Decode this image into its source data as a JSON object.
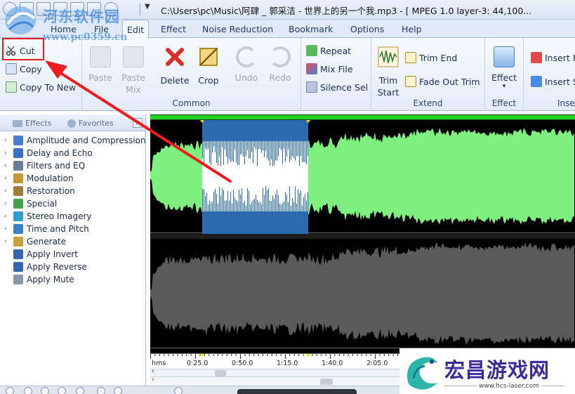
{
  "window": {
    "title": "C:\\Users\\pc\\Music\\阿肆 _ 郭采洁 - 世界上的另一个我.mp3 - [ MPEG 1.0 layer-3: 44,100..."
  },
  "tabs": [
    {
      "label": "Home"
    },
    {
      "label": "File"
    },
    {
      "label": "Edit",
      "active": true
    },
    {
      "label": "Effect"
    },
    {
      "label": "Noise Reduction"
    },
    {
      "label": "Bookmark"
    },
    {
      "label": "Options"
    },
    {
      "label": "Help"
    }
  ],
  "ribbon": {
    "clipboard": {
      "cut": "Cut",
      "copy": "Copy",
      "copy_to_new": "Copy To New"
    },
    "common": {
      "label": "Common",
      "paste_line1": "Paste",
      "paste_line2": "",
      "paste_mix_line1": "Paste",
      "paste_mix_line2": "Mix",
      "delete": "Delete",
      "crop": "Crop",
      "undo": "Undo",
      "redo": "Redo"
    },
    "mixgroup": {
      "repeat": "Repeat",
      "mix_file": "Mix File",
      "silence_sel": "Silence Sel"
    },
    "extend": {
      "label": "Extend",
      "trim_start_line1": "Trim",
      "trim_start_line2": "Start",
      "trim_end": "Trim End",
      "fade_out_trim": "Fade Out Trim"
    },
    "effect": {
      "label": "Effect",
      "button_line1": "Effect",
      "button_line2": "▾"
    },
    "insert": {
      "label": "Inse",
      "insert_f": "Insert F",
      "insert_s": "Insert S"
    }
  },
  "left_panel": {
    "tabs": {
      "effects": "Effects",
      "favorites": "Favorites",
      "close": "x"
    },
    "items": [
      {
        "label": "Amplitude and Compression",
        "expandable": true,
        "icon_color": "#4a7fd0"
      },
      {
        "label": "Delay and Echo",
        "expandable": true,
        "icon_color": "#3b6fc4"
      },
      {
        "label": "Filters and EQ",
        "expandable": true,
        "icon_color": "#6a7b96"
      },
      {
        "label": "Modulation",
        "expandable": true,
        "icon_color": "#c79632"
      },
      {
        "label": "Restoration",
        "expandable": true,
        "icon_color": "#a07a3a"
      },
      {
        "label": "Special",
        "expandable": true,
        "icon_color": "#48a04a"
      },
      {
        "label": "Stereo Imagery",
        "expandable": true,
        "icon_color": "#2f9fcf"
      },
      {
        "label": "Time and Pitch",
        "expandable": true,
        "icon_color": "#3a80c8"
      },
      {
        "label": "Generate",
        "expandable": true,
        "icon_color": "#c9a03a"
      },
      {
        "label": "Apply Invert",
        "expandable": false,
        "icon_color": "#3564b0"
      },
      {
        "label": "Apply Reverse",
        "expandable": false,
        "icon_color": "#3564b0"
      },
      {
        "label": "Apply Mute",
        "expandable": false,
        "icon_color": "#8896aa"
      }
    ]
  },
  "waveform": {
    "selection_start": 0.122,
    "selection_end": 0.372,
    "colors": {
      "background": "#000000",
      "channel1": "#7ef07e",
      "channel1_selected": "#2a6bb0",
      "selection_bg": "#ffffff",
      "channel2": "#5a5a5a"
    }
  },
  "timeline": {
    "labels": [
      "hms",
      "0:25.0",
      "0:50.0",
      "1:15.0",
      "1:40.0",
      "2:05.0"
    ]
  },
  "watermarks": {
    "left_title": "河东软件园",
    "left_url": "www.pc0359.cn",
    "right_title": "宏昌游戏网",
    "right_url": "www.hcs-laser.com"
  },
  "colors": {
    "annotation_red": "#ee1c1c",
    "ribbon_blue": "#dfe9f7"
  }
}
